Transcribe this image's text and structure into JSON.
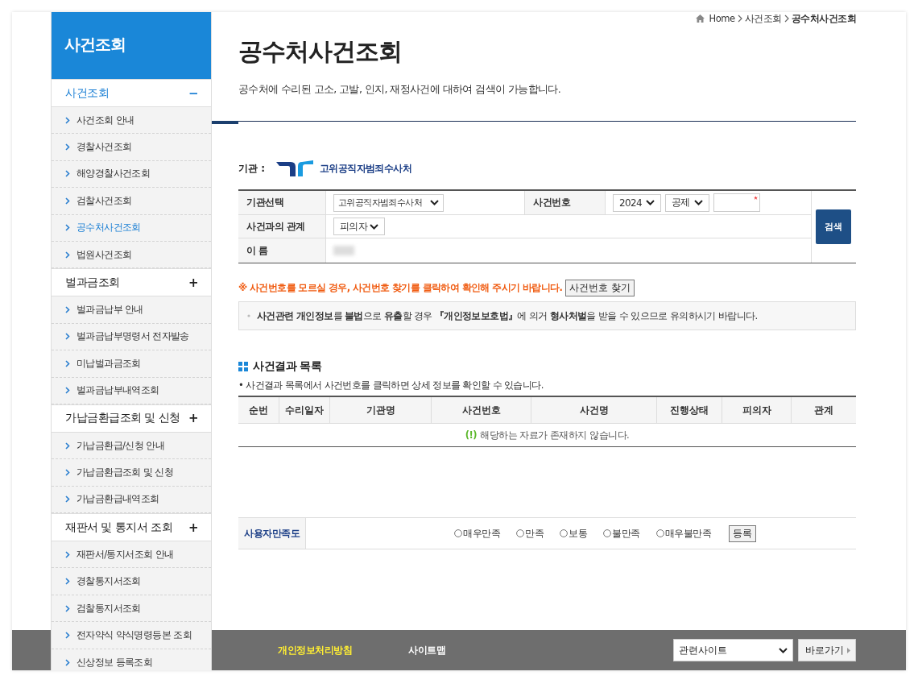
{
  "sidebar": {
    "title": "사건조회",
    "groups": [
      {
        "title": "사건조회",
        "toggle": "−",
        "expanded": true,
        "items": [
          {
            "label": "사건조회 안내",
            "selected": false
          },
          {
            "label": "경찰사건조회",
            "selected": false
          },
          {
            "label": "해양경찰사건조회",
            "selected": false
          },
          {
            "label": "검찰사건조회",
            "selected": false
          },
          {
            "label": "공수처사건조회",
            "selected": true
          },
          {
            "label": "법원사건조회",
            "selected": false
          }
        ]
      },
      {
        "title": "벌과금조회",
        "toggle": "+",
        "expanded": false,
        "items": [
          {
            "label": "벌과금납부 안내",
            "selected": false
          },
          {
            "label": "벌과금납부명령서 전자발송",
            "selected": false
          },
          {
            "label": "미납벌과금조회",
            "selected": false
          },
          {
            "label": "벌과금납부내역조회",
            "selected": false
          }
        ]
      },
      {
        "title": "가납금환급조회 및 신청",
        "toggle": "+",
        "expanded": false,
        "items": [
          {
            "label": "가납금환급/신청 안내",
            "selected": false
          },
          {
            "label": "가납금환급조회 및 신청",
            "selected": false
          },
          {
            "label": "가납금환급내역조회",
            "selected": false
          }
        ]
      },
      {
        "title": "재판서 및 통지서 조회",
        "toggle": "+",
        "expanded": false,
        "items": [
          {
            "label": "재판서/통지서조회 안내",
            "selected": false
          },
          {
            "label": "경찰통지서조회",
            "selected": false
          },
          {
            "label": "검찰통지서조회",
            "selected": false
          },
          {
            "label": "전자약식 약식명령등본 조회",
            "selected": false
          },
          {
            "label": "신상정보 등록조회",
            "selected": false
          }
        ]
      }
    ]
  },
  "breadcrumb": [
    "Home",
    "사건조회",
    "공수처사건조회"
  ],
  "page_title": "공수처사건조회",
  "description": "공수처에 수리된 고소, 고발, 인지, 재정사건에 대하여 검색이 가능합니다.",
  "agency": {
    "label": "기관 :",
    "name": "고위공직자범죄수사처"
  },
  "form": {
    "agency_label": "기관선택",
    "agency_value": "고위공직자범죄수사처",
    "case_label": "사건번호",
    "year_value": "2024",
    "type_value": "공제",
    "relation_label": "사건과의 관계",
    "relation_value": "피의자",
    "name_label": "이 름",
    "search_button": "검색"
  },
  "notice": "※ 사건번호를 모르실 경우, 사건번호 찾기를 클릭하여 확인해 주시기 바랍니다.",
  "find_button": "사건번호 찾기",
  "warning": "**사건관련 개인정보**를 **불법**으로 **유출**할 경우 **『개인정보보호법』**에 의거 **형사처벌**을 받을 수 있으므로 유의하시기 바랍니다.",
  "results": {
    "title": "사건결과 목록",
    "hint": "• 사건결과 목록에서 사건번호를 클릭하면 상세 정보를 확인할 수 있습니다.",
    "columns": [
      "순번",
      "수리일자",
      "기관명",
      "사건번호",
      "사건명",
      "진행상태",
      "피의자",
      "관계"
    ],
    "empty_mark": "(!)",
    "empty_text": "해당하는 자료가 존재하지 않습니다."
  },
  "satisfaction": {
    "label": "사용자만족도",
    "options": [
      {
        "label": "매우만족",
        "selected": false
      },
      {
        "label": "만족",
        "selected": false
      },
      {
        "label": "보통",
        "selected": false
      },
      {
        "label": "불만족",
        "selected": false
      },
      {
        "label": "매우불만족",
        "selected": false
      }
    ],
    "button": "등록"
  },
  "footer": {
    "links": [
      "개인정보처리방침",
      "사이트맵"
    ],
    "select": "관련사이트",
    "go_button": "바로가기"
  }
}
